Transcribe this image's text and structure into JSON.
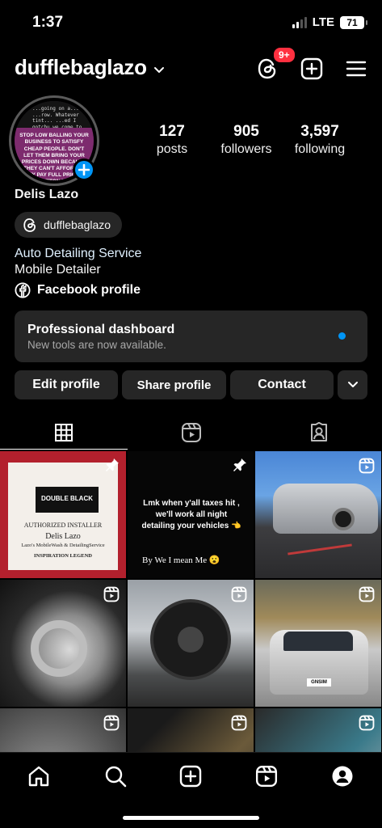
{
  "status_bar": {
    "time": "1:37",
    "network": "LTE",
    "battery": "71"
  },
  "header": {
    "username": "dufflebaglazo",
    "threads_notification_count": "9+",
    "icons": [
      "threads-icon",
      "create-icon",
      "menu-icon"
    ]
  },
  "profile": {
    "avatar_text_top": "...going on a... ...row. Whatever tint... ...ed I gotchu we come to your location hmu",
    "avatar_text_bottom": "STOP LOW BALLING YOUR BUSINESS TO SATISFY CHEAP PEOPLE. DON'T LET THEM BRING YOUR PRICES DOWN BECAUSE THEY CAN'T AFFORD IT. THEY PAY FULL PRICE AT LOUIS VUITTON THEY CAN PAY YOU",
    "stats": [
      {
        "value": "127",
        "label": "posts"
      },
      {
        "value": "905",
        "label": "followers"
      },
      {
        "value": "3,597",
        "label": "following"
      }
    ],
    "full_name": "Delis Lazo",
    "threads_handle": "dufflebaglazo",
    "bio_line1": "Auto Detailing Service",
    "bio_line2": "Mobile Detailer",
    "facebook_link": "Facebook profile"
  },
  "dashboard": {
    "title": "Professional dashboard",
    "subtitle": "New tools are now available."
  },
  "actions": {
    "edit": "Edit profile",
    "share": "Share profile",
    "contact": "Contact"
  },
  "posts": [
    {
      "type": "pinned",
      "title": "DOUBLE BLACK",
      "line1": "AUTHORIZED INSTALLER",
      "line2": "Delis Lazo",
      "line3": "Lazo's MobileWash & DetailingService",
      "line4": "INSPIRATION LEGEND"
    },
    {
      "type": "pinned",
      "caption1": "Lmk when y'all taxes hit ,",
      "caption2": "we'll work all night",
      "caption3": "detailing your vehicles 👈",
      "caption4": "By We I mean Me 😮"
    },
    {
      "type": "reel"
    },
    {
      "type": "reel"
    },
    {
      "type": "reel"
    },
    {
      "type": "reel",
      "plate": "GNSIM"
    },
    {
      "type": "reel"
    },
    {
      "type": "reel"
    },
    {
      "type": "reel"
    }
  ],
  "colors": {
    "accent": "#0095f6",
    "badge": "#ff3040",
    "surface": "#262626"
  }
}
